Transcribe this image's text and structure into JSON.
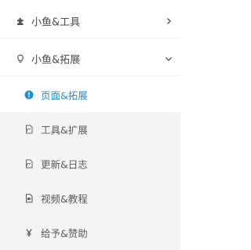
{
  "menu": {
    "items": [
      {
        "label": "小鱼&工具",
        "icon": "puzzle-icon",
        "expanded": false
      },
      {
        "label": "小鱼&拓展",
        "icon": "bulb-icon",
        "expanded": true
      }
    ],
    "sub_items": [
      {
        "label": "页面&拓展",
        "icon": "info-circle-icon",
        "active": true
      },
      {
        "label": "工具&扩展",
        "icon": "document-icon",
        "active": false
      },
      {
        "label": "更新&日志",
        "icon": "document-icon",
        "active": false
      },
      {
        "label": "视频&教程",
        "icon": "video-file-icon",
        "active": false
      },
      {
        "label": "给予&赞助",
        "icon": "yen-icon",
        "active": false
      }
    ]
  },
  "colors": {
    "accent": "#1b8fd8",
    "text": "#4b4b4b",
    "submenu_bg": "#f3f4f6",
    "divider": "#eef0f3"
  }
}
